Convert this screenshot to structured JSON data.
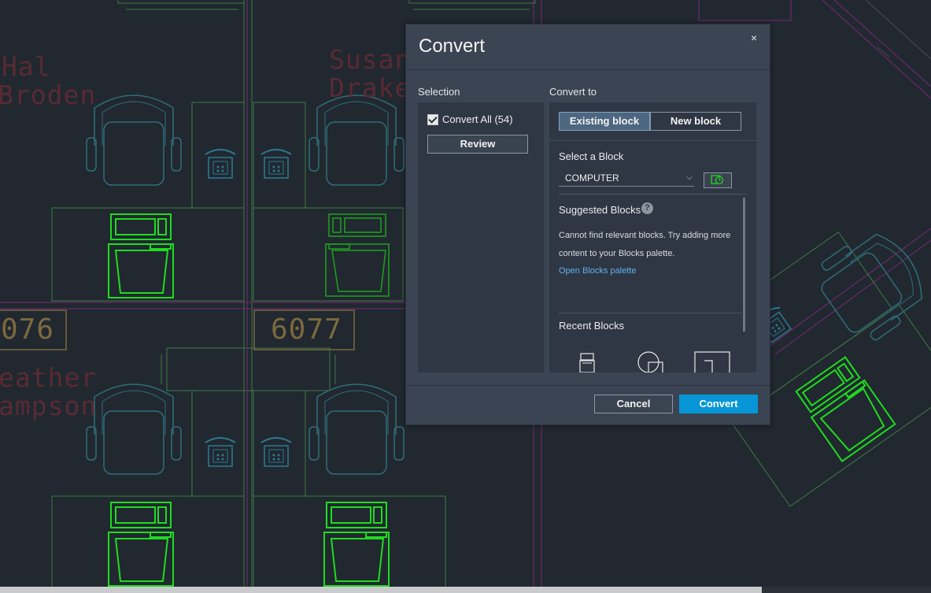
{
  "drawing": {
    "names": [
      "Hal",
      "Broden",
      "Susan",
      "Drake",
      "eather",
      "ampson"
    ],
    "room_numbers": [
      "076",
      "6077"
    ]
  },
  "dialog": {
    "title": "Convert",
    "close_glyph": "×",
    "selection": {
      "label": "Selection",
      "convert_all_label": "Convert All (54)",
      "convert_all_checked": true,
      "review_label": "Review"
    },
    "convert_to": {
      "label": "Convert to",
      "tabs": [
        {
          "label": "Existing block",
          "selected": true
        },
        {
          "label": "New block",
          "selected": false
        }
      ],
      "select_block_label": "Select a Block",
      "selected_block": "COMPUTER",
      "suggested_label": "Suggested Blocks",
      "help_glyph": "?",
      "suggested_message": "Cannot find relevant blocks. Try adding more content to your Blocks palette.",
      "open_palette_link": "Open Blocks palette",
      "recent_label": "Recent Blocks",
      "recent_icons": [
        "computer-block-icon",
        "chair-block-icon",
        "desk-block-icon"
      ]
    },
    "cancel_label": "Cancel",
    "convert_label": "Convert"
  },
  "colors": {
    "canvas_bg": "#212830",
    "dialog_bg": "#3b4453",
    "panel_bg": "#2f3744",
    "selected_block_lines": "#1fdc1f",
    "accent_button": "#0696d7",
    "link": "#5fb3ee"
  }
}
